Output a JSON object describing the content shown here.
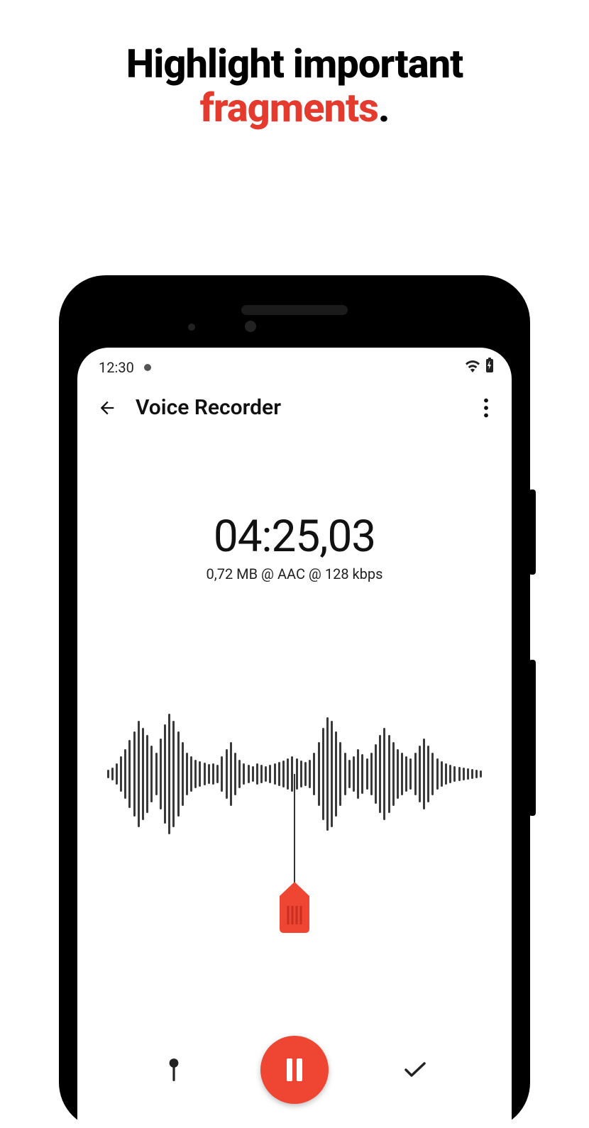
{
  "promo": {
    "line1": "Highlight important",
    "line2_accent": "fragments",
    "line2_suffix": "."
  },
  "status_bar": {
    "time": "12:30"
  },
  "app_bar": {
    "title": "Voice Recorder"
  },
  "recording": {
    "timer": "04:25,03",
    "file_info": "0,72 MB @ AAC @ 128 kbps"
  },
  "icons": {
    "back": "back-arrow-icon",
    "more": "more-vert-icon",
    "wifi": "wifi-icon",
    "battery": "battery-icon",
    "pin": "pin-icon",
    "pause": "pause-icon",
    "check": "check-icon",
    "tag": "tag-marker-icon"
  },
  "colors": {
    "accent": "#ee4632",
    "accent_text": "#e53a2e"
  },
  "waveform": {
    "bars": [
      12,
      18,
      30,
      50,
      70,
      96,
      120,
      150,
      130,
      110,
      80,
      60,
      100,
      140,
      170,
      150,
      120,
      90,
      60,
      50,
      40,
      36,
      32,
      28,
      30,
      26,
      50,
      70,
      90,
      60,
      40,
      30,
      26,
      22,
      30,
      26,
      22,
      26,
      30,
      34,
      38,
      44,
      50,
      44,
      38,
      34,
      40,
      60,
      90,
      130,
      160,
      150,
      120,
      90,
      60,
      40,
      50,
      70,
      56,
      44,
      60,
      84,
      110,
      130,
      110,
      90,
      70,
      60,
      50,
      44,
      60,
      80,
      100,
      80,
      60,
      44,
      36,
      30,
      26,
      22,
      20,
      18,
      16,
      14,
      12,
      10
    ]
  }
}
